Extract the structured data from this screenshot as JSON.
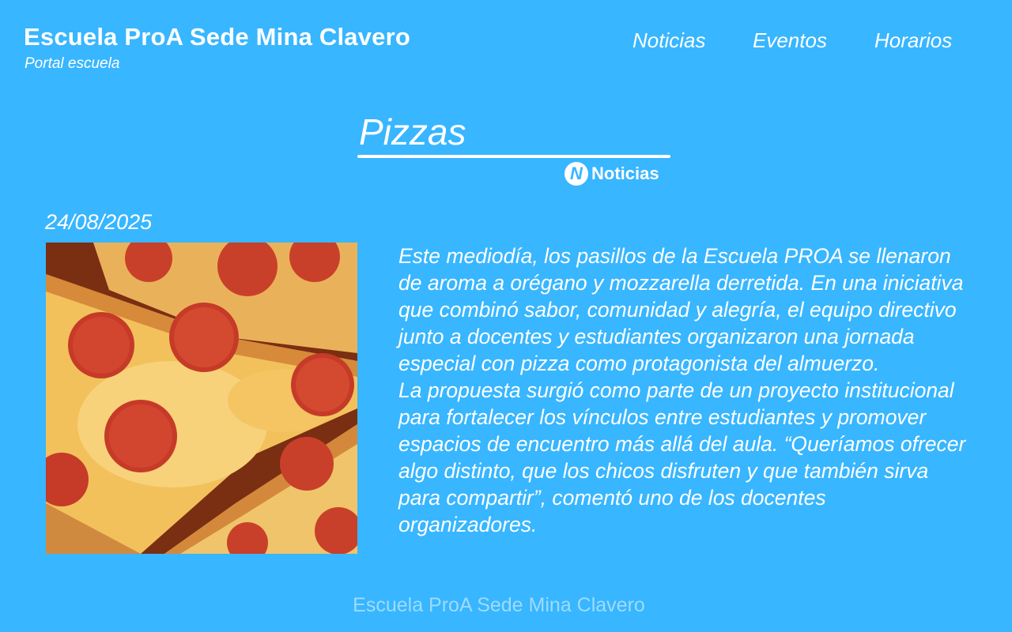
{
  "site": {
    "title": "Escuela ProA Sede Mina Clavero",
    "subtitle": "Portal escuela"
  },
  "nav": {
    "items": [
      "Noticias",
      "Eventos",
      "Horarios"
    ]
  },
  "article": {
    "title": "Pizzas",
    "category": {
      "icon": "news-n-icon",
      "icon_letter": "N",
      "label": "Noticias"
    },
    "date": "24/08/2025",
    "image": {
      "subject": "pepperoni-pizza-photo"
    },
    "paragraphs": [
      "Este mediodía, los pasillos de la Escuela PROA se llenaron de aroma a orégano y mozzarella derretida. En una iniciativa que combinó sabor, comunidad y alegría, el equipo directivo junto a docentes y estudiantes organizaron una jornada especial con pizza como protagonista del almuerzo.",
      "La propuesta surgió como parte de un proyecto institucional para fortalecer los vínculos entre estudiantes y promover espacios de encuentro más allá del aula. “Queríamos ofrecer algo distinto, que los chicos disfruten y que también sirva para compartir”, comentó uno de los docentes organizadores."
    ]
  },
  "footer": {
    "text": "Escuela ProA Sede Mina Clavero"
  },
  "colors": {
    "background": "#38b6ff",
    "text": "#ffffff",
    "footer_text": "#9edbff"
  }
}
